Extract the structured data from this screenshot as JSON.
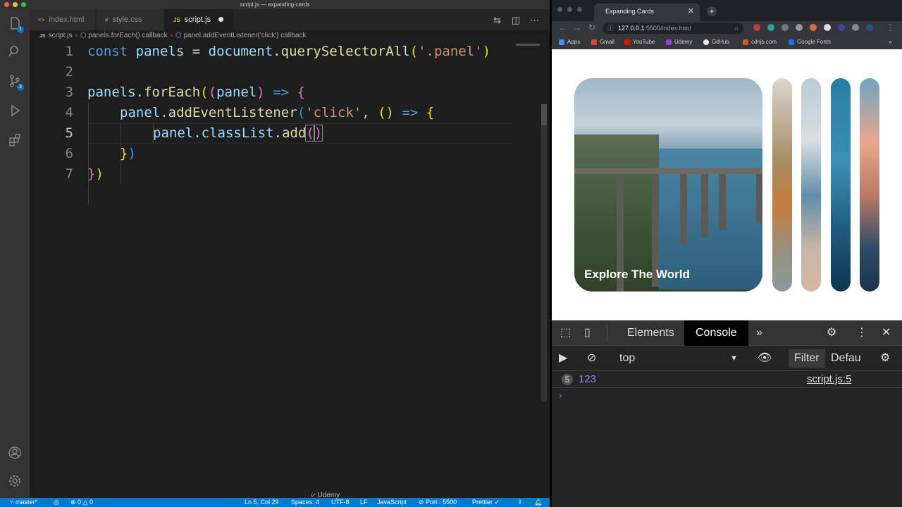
{
  "vscode": {
    "window_title": "script.js — expanding-cards",
    "tabs": [
      {
        "label": "index.html",
        "icon": "<>"
      },
      {
        "label": "style.css",
        "icon": "#"
      },
      {
        "label": "script.js",
        "icon": "JS"
      }
    ],
    "breadcrumb": [
      "script.js",
      "panels.forEach() callback",
      "panel.addEventListener('click') callback"
    ],
    "activity_badges": {
      "explorer": "1",
      "scm": "3"
    },
    "line_numbers": [
      "1",
      "2",
      "3",
      "4",
      "5",
      "6",
      "7"
    ],
    "code": {
      "l1": {
        "kw": "const",
        "var": "panels",
        "eq": "=",
        "obj": "document",
        "fn": "querySelectorAll",
        "str": "'.panel'"
      },
      "l3": {
        "var": "panels",
        "fn": "forEach",
        "param": "panel",
        "arrow": "=>"
      },
      "l4": {
        "var": "panel",
        "fn": "addEventListener",
        "str": "'click'",
        "arrow": "=>"
      },
      "l5": {
        "var": "panel",
        "prop": "classList",
        "fn": "add"
      }
    },
    "status": {
      "branch": "master*",
      "errors": "0",
      "warnings": "0",
      "position": "Ln 5, Col 29",
      "spaces": "Spaces: 4",
      "encoding": "UTF-8",
      "eol": "LF",
      "language": "JavaScript",
      "port": "Port : 5500",
      "prettier": "Prettier"
    }
  },
  "chrome": {
    "tab_title": "Expanding Cards",
    "url_host": "127.0.0.1",
    "url_rest": ":5500/index.html",
    "bookmarks": [
      "Apps",
      "Gmail",
      "YouTube",
      "Udemy",
      "GitHub",
      "cdnjs.com",
      "Google Fonts"
    ],
    "page": {
      "active_panel_title": "Explore The World"
    }
  },
  "devtools": {
    "tabs": [
      "Elements",
      "Console"
    ],
    "context": "top",
    "filter": "Filter",
    "levels": "Defau",
    "log": {
      "count": "5",
      "message": "123",
      "source": "script.js:5"
    }
  },
  "watermark": "Udemy",
  "colors": {
    "accent": "#007acc",
    "keyword": "#569cd6",
    "string": "#ce9178",
    "function": "#dcdcaa"
  }
}
